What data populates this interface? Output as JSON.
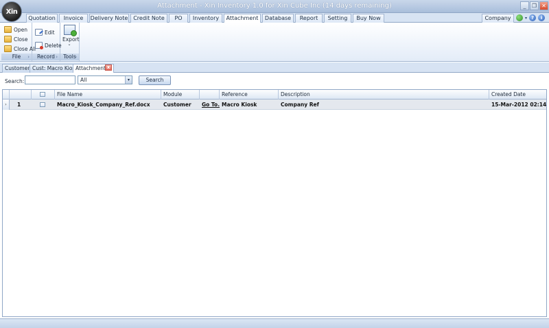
{
  "window": {
    "title": "Attachment - Xin Inventory 1.0 for Xin Cube Inc (14 days remaining)",
    "logo_text": "Xin",
    "minimize_glyph": "_",
    "restore_glyph": "❐",
    "close_glyph": "✕"
  },
  "ribbon_tabs": [
    "Quotation",
    "Invoice",
    "Delivery Note",
    "Credit Note",
    "PO",
    "Inventory",
    "Attachment",
    "Database",
    "Report",
    "Setting",
    "Buy Now"
  ],
  "active_tab": "Attachment",
  "company_tab": "Company",
  "right_icons": [
    "globe-icon",
    "help-icon",
    "info-icon"
  ],
  "right_glyphs": {
    "help": "?",
    "info": "i",
    "dropdown": "▾"
  },
  "ribbon": {
    "file": {
      "label": "File",
      "open": "Open",
      "close": "Close",
      "close_all": "Close All"
    },
    "record": {
      "label": "Record",
      "edit": "Edit",
      "delete": "Delete"
    },
    "tools": {
      "label": "Tools",
      "export": "Export",
      "export_arrow": "⌄"
    },
    "launcher_glyph": "›"
  },
  "doc_tabs": {
    "customer": "Customer",
    "cust_macro_kiosk": "Cust: Macro Kiosk",
    "attachment": "Attachment",
    "close_glyph": "x"
  },
  "search": {
    "label": "Search:",
    "value": "",
    "scope": "All",
    "arrow": "▾",
    "button": "Search"
  },
  "grid": {
    "columns": {
      "file_name": "File Name",
      "module": "Module",
      "reference": "Reference",
      "description": "Description",
      "created_date": "Created Date"
    },
    "rows": [
      {
        "indicator": "›",
        "num": "1",
        "file_name": "Macro_Kiosk_Company_Ref.docx",
        "module": "Customer",
        "link": "Go To...",
        "reference": "Macro Kiosk",
        "description": "Company Ref",
        "created_date": "15-Mar-2012 02:14"
      }
    ]
  },
  "colors": {
    "accent": "#a9bedb",
    "row_highlight": "#e4e8ee",
    "close_red": "#d64b2c"
  }
}
